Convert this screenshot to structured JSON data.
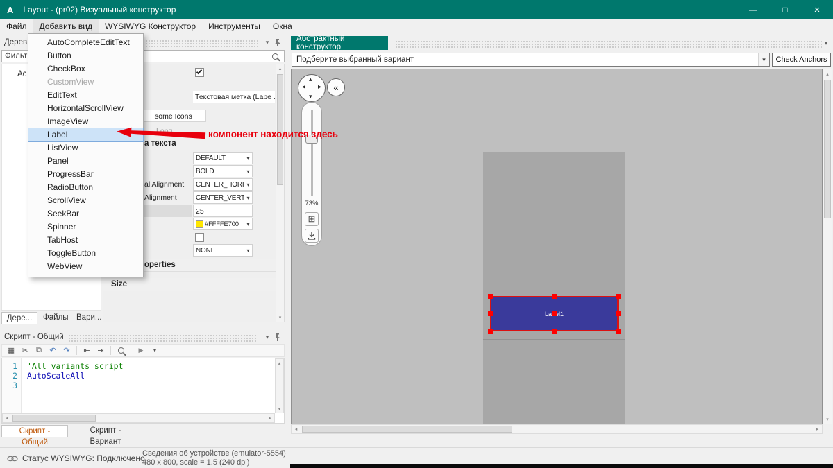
{
  "window": {
    "logo": "A",
    "title": "Layout - (pr02) Визуальный конструктор"
  },
  "icons": {
    "minimize": "—",
    "maximize": "□",
    "close": "×",
    "chevron_down": "▾",
    "chevron_up": "▴",
    "chevron_left": "◂",
    "chevron_right": "▸",
    "double_chevron_left": "«",
    "new_window": "▦",
    "cut": "✂",
    "copy": "⧉",
    "undo": "↶",
    "redo": "↷",
    "outdent": "⇤",
    "indent": "⇥",
    "run": "▶",
    "grid": "⊞"
  },
  "menubar": {
    "items": [
      {
        "label": "Файл"
      },
      {
        "label": "Добавить вид"
      },
      {
        "label": "WYSIWYG Конструктор"
      },
      {
        "label": "Инструменты"
      },
      {
        "label": "Окна"
      }
    ]
  },
  "add_view_menu": {
    "items": [
      {
        "label": "AutoCompleteEditText",
        "state": "normal"
      },
      {
        "label": "Button",
        "state": "normal"
      },
      {
        "label": "CheckBox",
        "state": "normal"
      },
      {
        "label": "CustomView",
        "state": "disabled"
      },
      {
        "label": "EditText",
        "state": "normal"
      },
      {
        "label": "HorizontalScrollView",
        "state": "normal"
      },
      {
        "label": "ImageView",
        "state": "normal"
      },
      {
        "label": "Label",
        "state": "hover"
      },
      {
        "label": "ListView",
        "state": "normal"
      },
      {
        "label": "Panel",
        "state": "normal"
      },
      {
        "label": "ProgressBar",
        "state": "normal"
      },
      {
        "label": "RadioButton",
        "state": "normal"
      },
      {
        "label": "ScrollView",
        "state": "normal"
      },
      {
        "label": "SeekBar",
        "state": "normal"
      },
      {
        "label": "Spinner",
        "state": "normal"
      },
      {
        "label": "TabHost",
        "state": "normal"
      },
      {
        "label": "ToggleButton",
        "state": "normal"
      },
      {
        "label": "WebView",
        "state": "normal"
      }
    ]
  },
  "annotation": {
    "text": "компонент находится здесь",
    "color": "#E8000D"
  },
  "tree_panel": {
    "title": "Дерев",
    "filter_text": "Фильт",
    "node_fragment": "Ac"
  },
  "properties_panel": {
    "text_value": "Текстовая метка (Labe ...",
    "icons_button_fragment": "some Icons",
    "gray_fragment": "Long",
    "section_text_fragment": "а текста",
    "rows": [
      {
        "label": "",
        "value": "DEFAULT"
      },
      {
        "label": "",
        "value": "BOLD"
      },
      {
        "label": "al Alignment",
        "value": "CENTER_HORIZONTAL"
      },
      {
        "label": "Alignment",
        "value": "CENTER_VERTICAL"
      },
      {
        "label": "",
        "value": "25"
      },
      {
        "label": "",
        "value": "#FFFFE700"
      },
      {
        "label": "",
        "value": ""
      },
      {
        "label": "",
        "value": "NONE"
      }
    ],
    "color_swatch": "#FFE700",
    "section_properties_fragment": "operties",
    "section_size": "Size"
  },
  "left_tabs": [
    {
      "label": "Дере..."
    },
    {
      "label": "Файлы"
    },
    {
      "label": "Вари..."
    }
  ],
  "script_panel": {
    "title": "Скрипт - Общий",
    "lines": [
      {
        "n": "1",
        "code": "'All variants script"
      },
      {
        "n": "2",
        "code": "AutoScaleAll"
      },
      {
        "n": "3",
        "code": ""
      }
    ],
    "tabs": [
      {
        "label": "Скрипт - Общий"
      },
      {
        "label": "Скрипт - Вариант"
      }
    ]
  },
  "designer": {
    "tab_title": "Абстрактный конструктор",
    "variant_selector": "Подберите выбранный вариант",
    "check_anchors_label": "Check Anchors",
    "zoom_value": "73%",
    "label_component_text": "Label1"
  },
  "statusbar": {
    "wysiwyg_status": "Статус WYSIWYG: Подключено",
    "device_info_line1": "Сведения об устройстве (emulator-5554)",
    "device_info_line2": "480 x 800, scale = 1.5 (240 dpi)"
  },
  "colors": {
    "titlebar_teal": "#00786D",
    "annotation_red": "#E8000D",
    "selection_red": "#FF0000",
    "label_fill": "#3A3A9B",
    "swatch_yellow": "#FFE700"
  }
}
